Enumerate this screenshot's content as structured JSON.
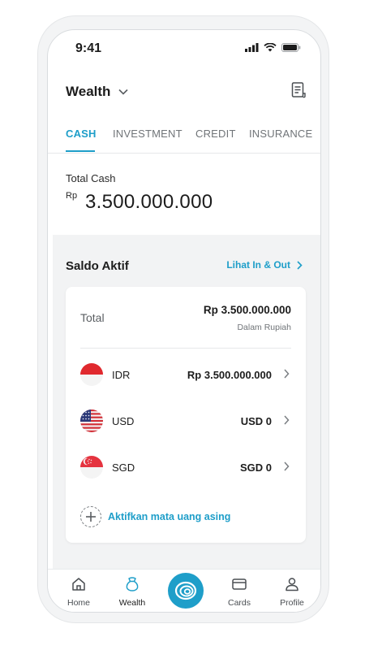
{
  "status": {
    "time": "9:41"
  },
  "header": {
    "title": "Wealth"
  },
  "tabs": [
    {
      "label": "CASH",
      "active": true
    },
    {
      "label": "INVESTMENT",
      "active": false
    },
    {
      "label": "CREDIT",
      "active": false
    },
    {
      "label": "INSURANCE",
      "active": false
    }
  ],
  "total_cash": {
    "label": "Total Cash",
    "currency": "Rp",
    "value": "3.500.000.000"
  },
  "saldo": {
    "title": "Saldo Aktif",
    "link_label": "Lihat In & Out",
    "total_label": "Total",
    "total_value": "Rp 3.500.000.000",
    "total_sub": "Dalam Rupiah",
    "currencies": [
      {
        "code": "IDR",
        "value": "Rp 3.500.000.000",
        "flag": "indonesia-flag-icon"
      },
      {
        "code": "USD",
        "value": "USD 0",
        "flag": "usa-flag-icon"
      },
      {
        "code": "SGD",
        "value": "SGD 0",
        "flag": "singapore-flag-icon"
      }
    ],
    "add_label": "Aktifkan mata uang asing"
  },
  "nav": {
    "items": [
      {
        "label": "Home",
        "icon": "home-icon"
      },
      {
        "label": "Wealth",
        "icon": "wealth-icon",
        "active": true
      },
      {
        "label": "Cards",
        "icon": "card-icon"
      },
      {
        "label": "Profile",
        "icon": "profile-icon"
      }
    ]
  },
  "colors": {
    "accent": "#1e9ec9",
    "background": "#f2f3f4"
  }
}
